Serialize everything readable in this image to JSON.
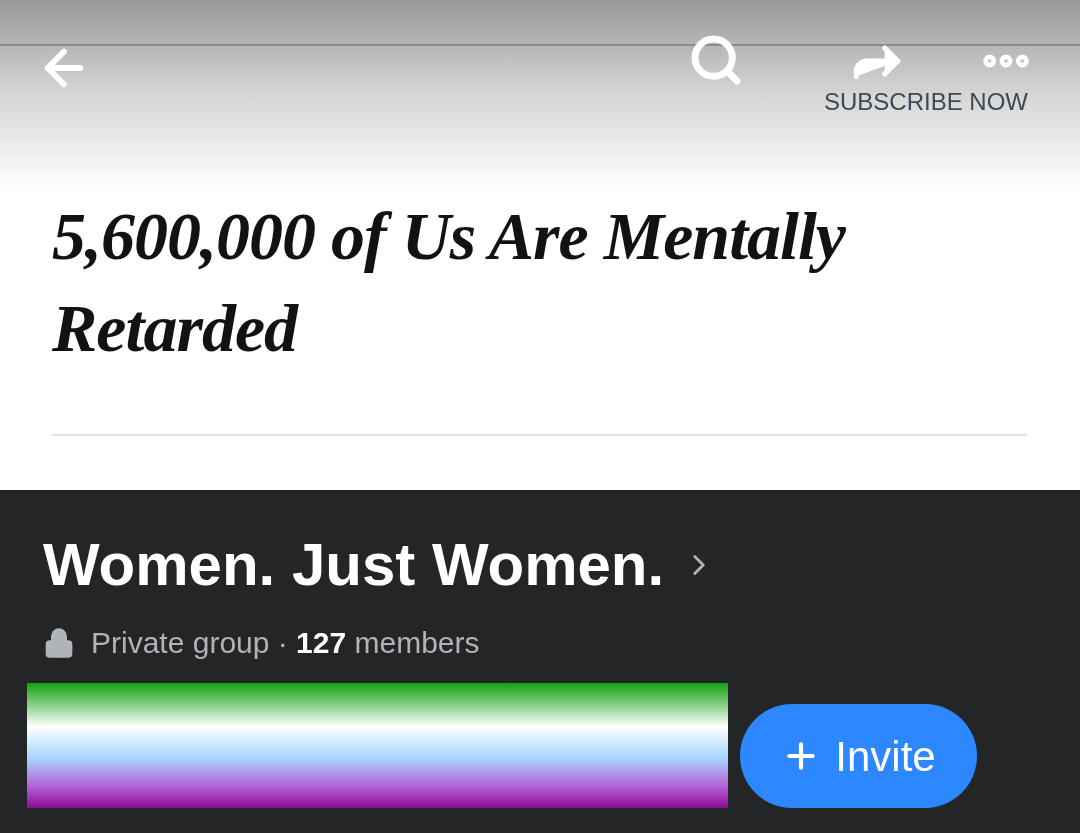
{
  "article": {
    "subscribe": "SUBSCRIBE NOW",
    "headline": "5,600,000 of Us Are Mentally Retarded"
  },
  "group": {
    "name": "Women. Just Women.",
    "meta": "Private group · **127** members",
    "invite": "Invite"
  }
}
